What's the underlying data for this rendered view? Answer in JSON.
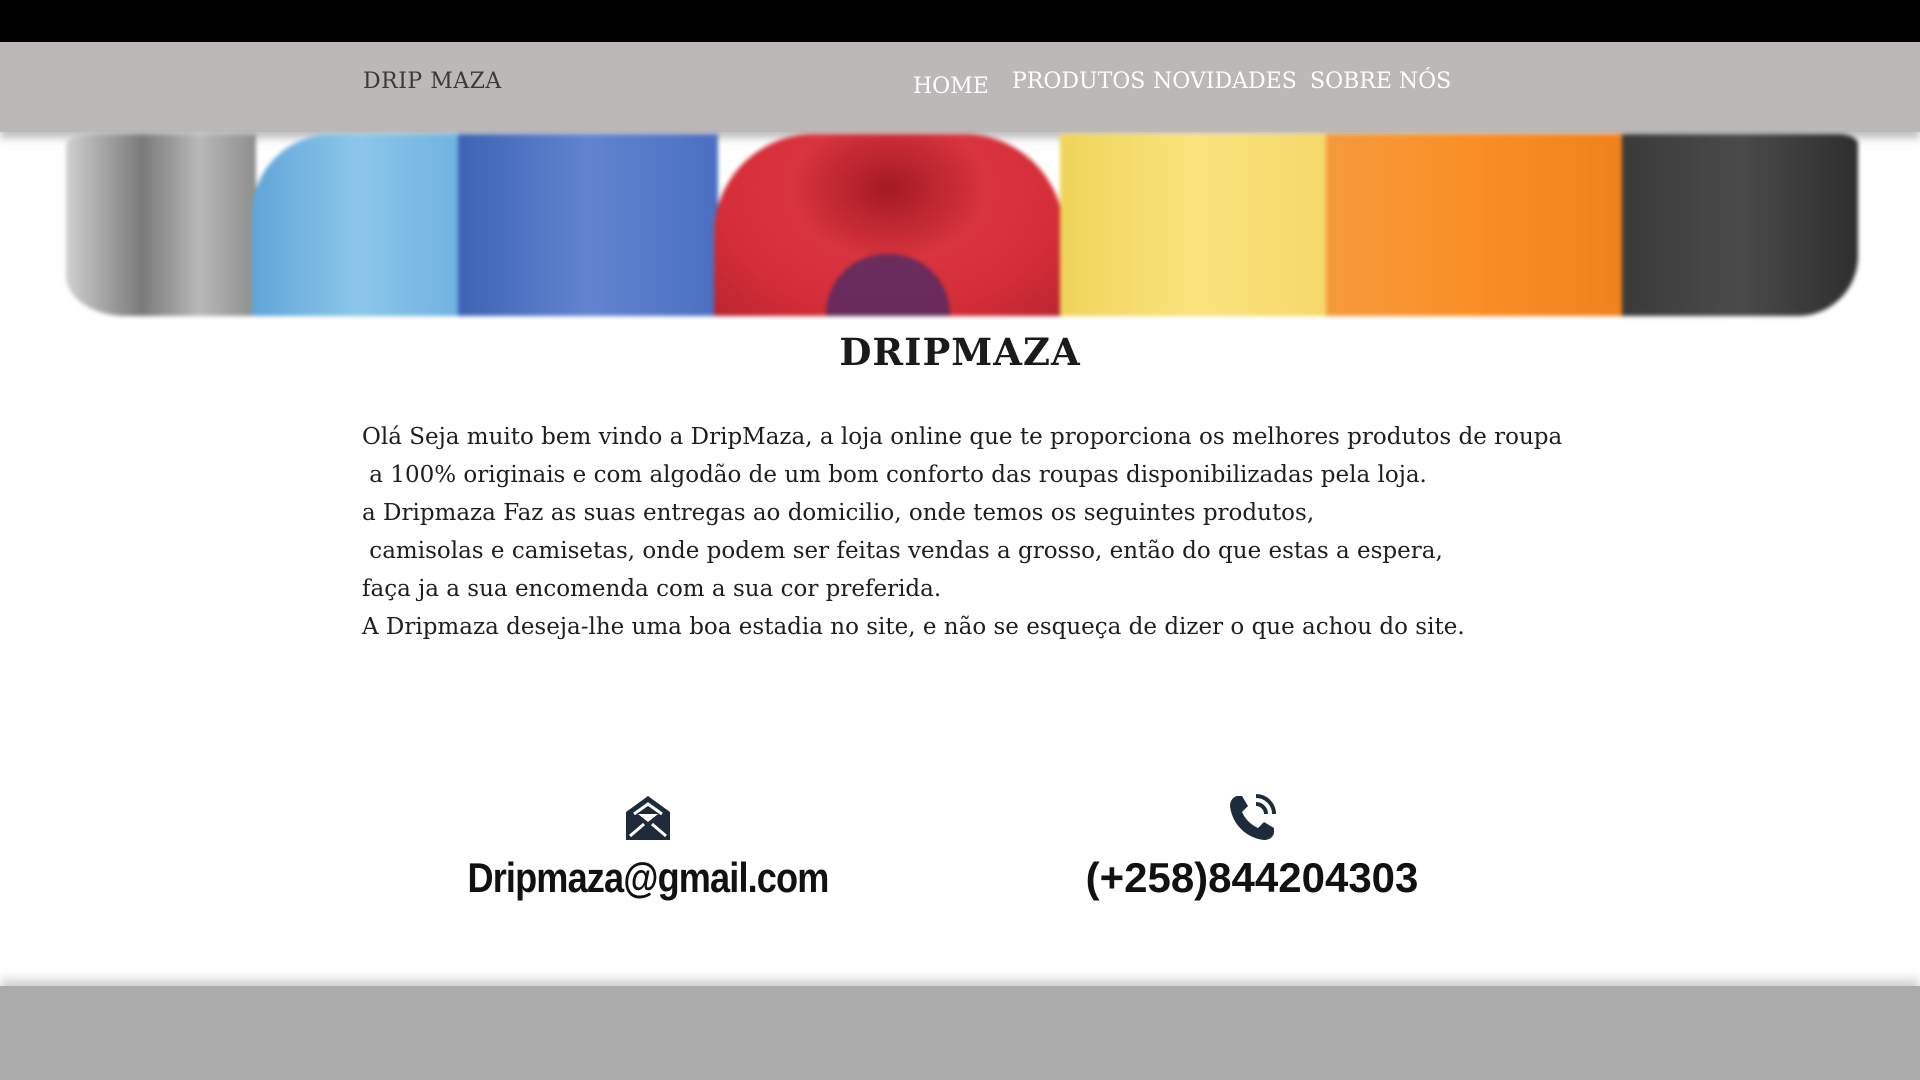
{
  "header": {
    "brand": "DRIP MAZA",
    "nav": [
      {
        "label": "HOME"
      },
      {
        "label": "PRODUTOS"
      },
      {
        "label": "NOVIDADES"
      },
      {
        "label": "SOBRE NÓS"
      }
    ]
  },
  "hero": {
    "image_desc_icon": "hoodies-banner"
  },
  "main": {
    "title": "DRIPMAZA",
    "paragraph_lines": [
      "Olá Seja muito bem vindo a DripMaza, a loja online que te proporciona os melhores produtos de roupa",
      " a 100% originais e com algodão de um bom conforto das roupas disponibilizadas pela loja.",
      "a Dripmaza Faz as suas entregas ao domicilio, onde temos os seguintes produtos,",
      " camisolas e camisetas, onde podem ser feitas vendas a grosso, então do que estas a espera,",
      "faça ja a sua encomenda com a sua cor preferida.",
      "A Dripmaza deseja-lhe uma boa estadia no site, e não se esqueça de dizer o que achou do site."
    ]
  },
  "contacts": {
    "email": {
      "icon": "envelope-open-icon",
      "text": "Dripmaza@gmail.com"
    },
    "phone": {
      "icon": "phone-call-icon",
      "text": "(+258)844204303"
    }
  },
  "colors": {
    "top_bar": "#000000",
    "navbar": "#bdb8b8",
    "footer": "#ababab",
    "icon": "#1d2b3a"
  }
}
